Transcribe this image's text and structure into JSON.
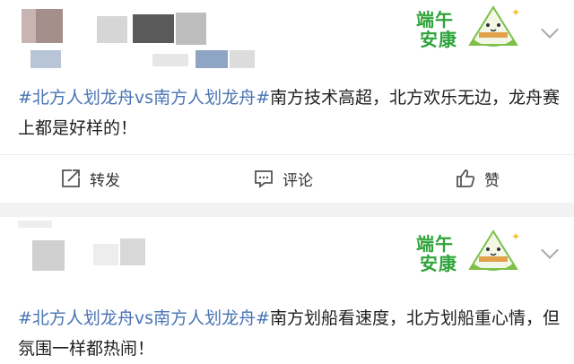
{
  "posts": [
    {
      "badge": {
        "line1": "端午",
        "line2": "安康"
      },
      "topic": "#北方人划龙舟vs南方人划龙舟#",
      "body": "南方技术高超，北方欢乐无边，龙舟赛上都是好样的！",
      "actions": {
        "repost": "转发",
        "comment": "评论",
        "like": "赞"
      }
    },
    {
      "badge": {
        "line1": "端午",
        "line2": "安康"
      },
      "topic": "#北方人划龙舟vs南方人划龙舟#",
      "body": "南方划船看速度，北方划船重心情，但氛围一样都热闹！"
    }
  ],
  "colors": {
    "topic": "#4a74b4",
    "badge_green": "#2fa43a",
    "separator": "#f2f2f2"
  },
  "icons": [
    "repost-icon",
    "comment-icon",
    "like-icon",
    "chevron-down-icon",
    "zongzi-icon"
  ]
}
